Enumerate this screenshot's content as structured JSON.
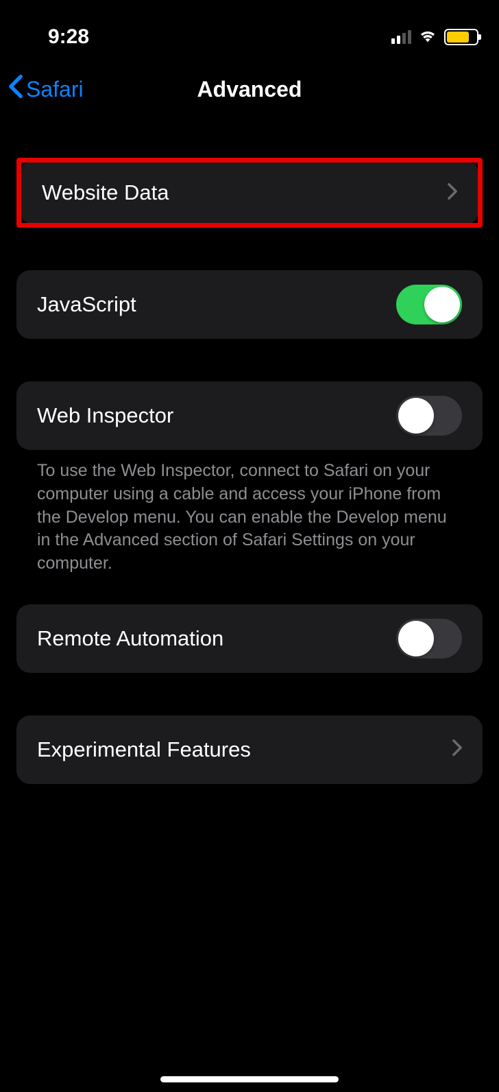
{
  "status": {
    "time": "9:28"
  },
  "nav": {
    "back_label": "Safari",
    "title": "Advanced"
  },
  "rows": {
    "website_data": {
      "label": "Website Data"
    },
    "javascript": {
      "label": "JavaScript",
      "on": true
    },
    "web_inspector": {
      "label": "Web Inspector",
      "on": false
    },
    "remote_automation": {
      "label": "Remote Automation",
      "on": false
    },
    "experimental": {
      "label": "Experimental Features"
    }
  },
  "footers": {
    "web_inspector": "To use the Web Inspector, connect to Safari on your computer using a cable and access your iPhone from the Develop menu. You can enable the Develop menu in the Advanced section of Safari Settings on your computer."
  }
}
